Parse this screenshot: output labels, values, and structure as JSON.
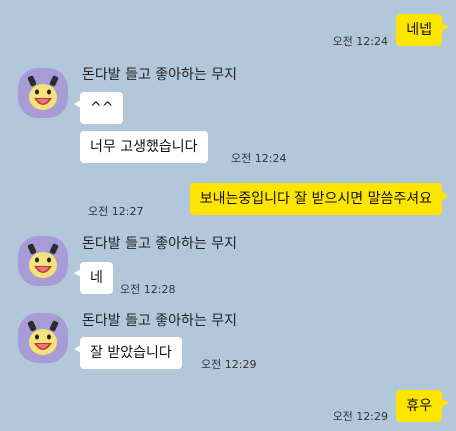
{
  "chat": {
    "sender_name": "돈다발 들고 좋아하는 무지",
    "messages": [
      {
        "text": "네넵",
        "time": "오전 12:24"
      },
      {
        "text": "^^"
      },
      {
        "text": "너무 고생했습니다",
        "time": "오전 12:24"
      },
      {
        "text": "보내는중입니다 잘 받으시면 말씀주셔요",
        "time": "오전 12:27"
      },
      {
        "text": "네",
        "time": "오전 12:28"
      },
      {
        "text": "잘 받았습니다",
        "time": "오전 12:29"
      },
      {
        "text": "휴우",
        "time": "오전 12:29"
      }
    ]
  },
  "colors": {
    "background": "#b2c7da",
    "outgoing_bubble": "#fee500",
    "incoming_bubble": "#ffffff",
    "avatar_bg": "#a89cd6"
  },
  "icons": {
    "avatar": "muzi-holding-money-avatar-icon"
  }
}
